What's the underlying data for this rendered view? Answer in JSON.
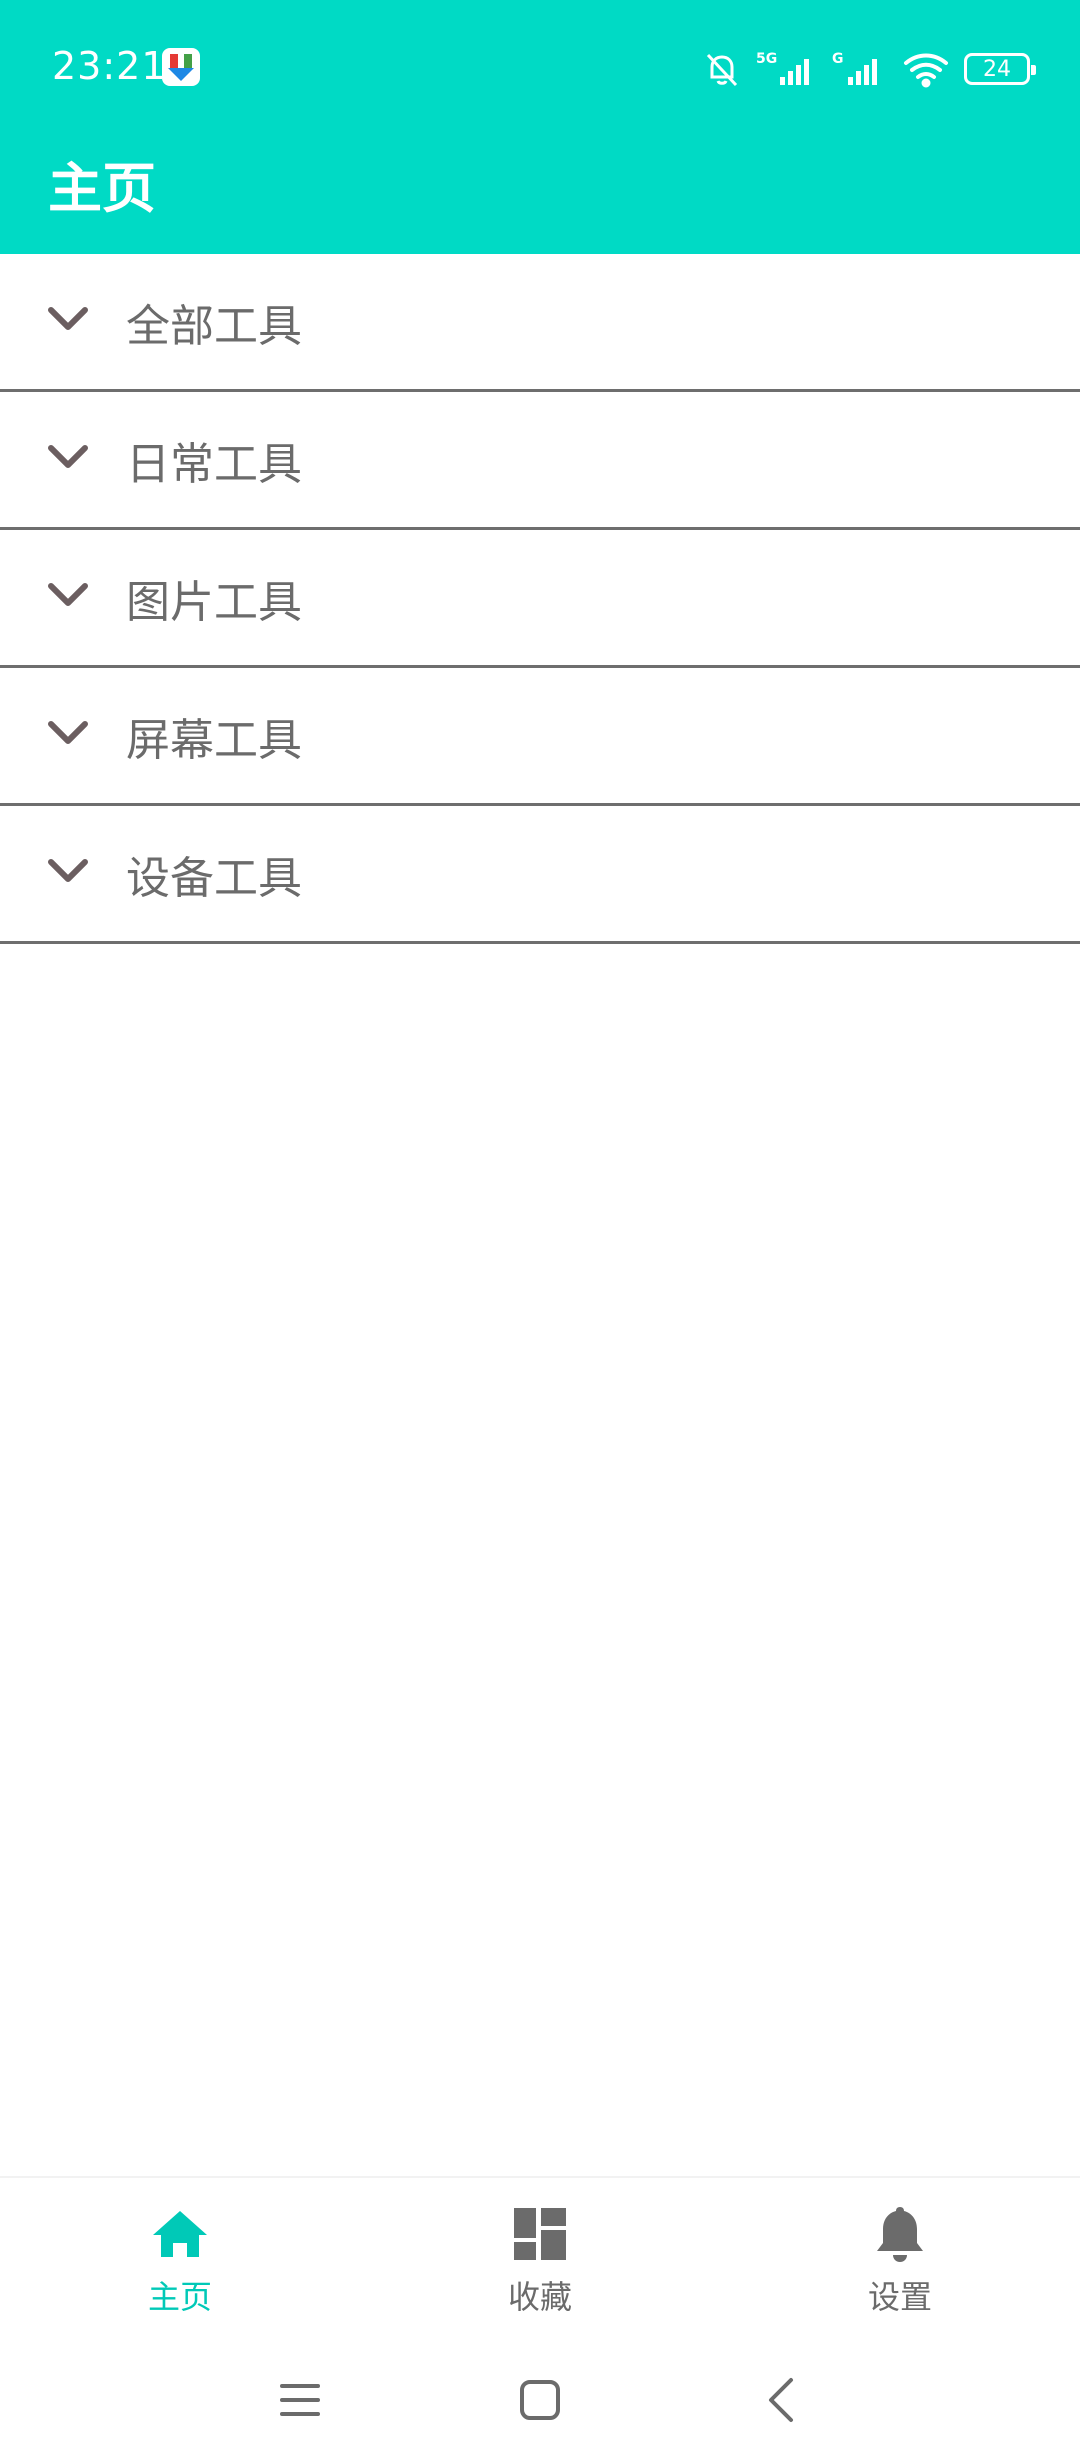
{
  "status_bar": {
    "time": "23:21",
    "battery": "24"
  },
  "app_bar": {
    "title": "主页"
  },
  "categories": [
    {
      "label": "全部工具"
    },
    {
      "label": "日常工具"
    },
    {
      "label": "图片工具"
    },
    {
      "label": "屏幕工具"
    },
    {
      "label": "设备工具"
    }
  ],
  "bottom_nav": {
    "items": [
      {
        "label": "主页",
        "icon": "home-icon",
        "active": true
      },
      {
        "label": "收藏",
        "icon": "dashboard-icon",
        "active": false
      },
      {
        "label": "设置",
        "icon": "bell-icon",
        "active": false
      }
    ]
  },
  "colors": {
    "accent": "#00DAC5",
    "text": "#6B6B6B",
    "divider": "#6E6E6E"
  }
}
